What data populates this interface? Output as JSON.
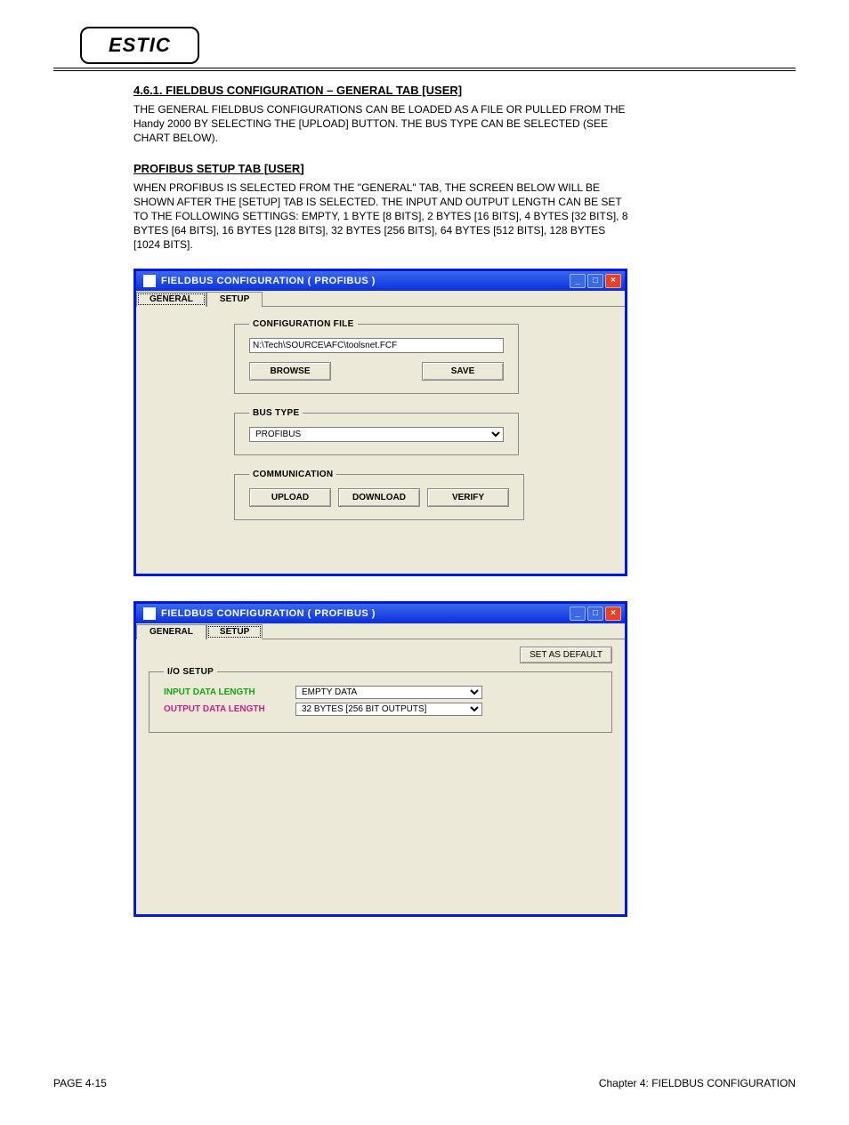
{
  "header": {
    "logo": "ESTIC"
  },
  "section1": {
    "heading": "4.6.1. FIELDBUS CONFIGURATION – GENERAL TAB [USER]",
    "text": "THE GENERAL FIELDBUS CONFIGURATIONS CAN BE LOADED AS A FILE OR PULLED FROM THE Handy 2000 BY SELECTING THE [UPLOAD] BUTTON. THE BUS TYPE CAN BE SELECTED (SEE CHART BELOW)."
  },
  "section2": {
    "heading": "PROFIBUS SETUP TAB [USER]",
    "text": "WHEN PROFIBUS IS SELECTED FROM THE \"GENERAL\" TAB, THE SCREEN BELOW WILL BE SHOWN AFTER THE [SETUP] TAB IS SELECTED. THE INPUT AND OUTPUT LENGTH CAN BE SET TO THE FOLLOWING SETTINGS: EMPTY, 1 BYTE [8 BITS], 2 BYTES [16 BITS], 4 BYTES [32 BITS], 8 BYTES [64 BITS], 16 BYTES [128 BITS], 32 BYTES [256 BITS], 64 BYTES [512 BITS], 128 BYTES [1024 BITS]."
  },
  "dialog": {
    "title": "FIELDBUS CONFIGURATION ( PROFIBUS )",
    "tabs": {
      "general": "GENERAL",
      "setup": "SETUP"
    },
    "general": {
      "config_file_legend": "CONFIGURATION FILE",
      "config_file_value": "N:\\Tech\\SOURCE\\AFC\\toolsnet.FCF",
      "browse": "BROWSE",
      "save": "SAVE",
      "bus_type_legend": "BUS TYPE",
      "bus_type_value": "PROFIBUS",
      "communication_legend": "COMMUNICATION",
      "upload": "UPLOAD",
      "download": "DOWNLOAD",
      "verify": "VERIFY"
    },
    "setup": {
      "set_default": "SET AS DEFAULT",
      "io_setup_legend": "I/O SETUP",
      "input_label": "INPUT DATA LENGTH",
      "input_value": "EMPTY DATA",
      "output_label": "OUTPUT DATA LENGTH",
      "output_value": "32 BYTES [256 BIT OUTPUTS]"
    }
  },
  "footer": {
    "left": "PAGE 4-15",
    "right": "Chapter 4: FIELDBUS CONFIGURATION"
  }
}
